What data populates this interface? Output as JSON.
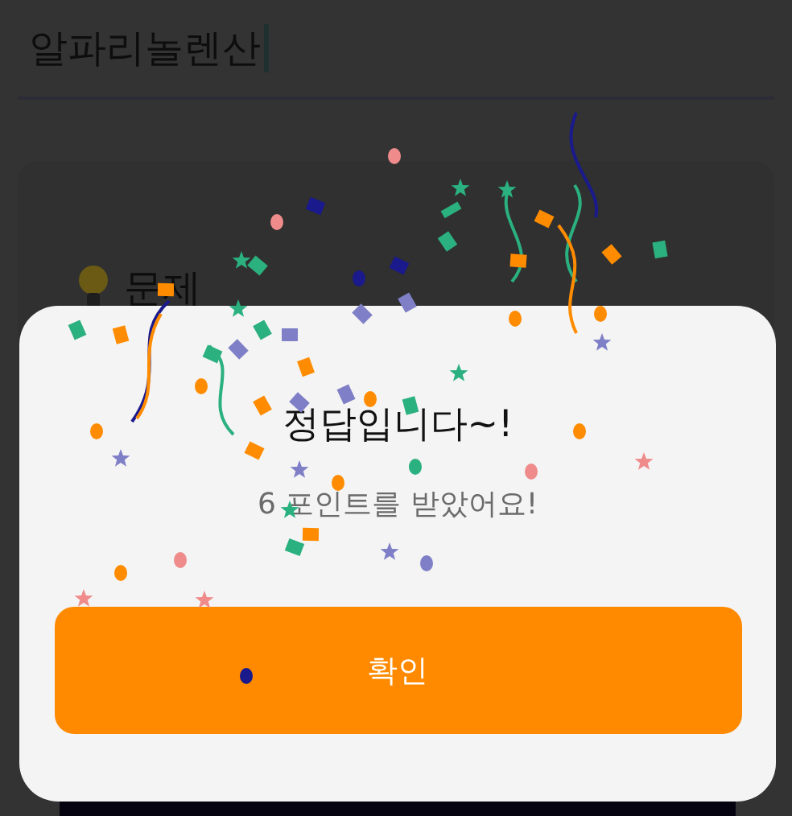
{
  "answer_field": {
    "value": "알파리놀렌산"
  },
  "question_card": {
    "title": "문제"
  },
  "result_dialog": {
    "title": "정답입니다~!",
    "message": "6 포인트를 받았어요!",
    "confirm_button": "확인"
  }
}
